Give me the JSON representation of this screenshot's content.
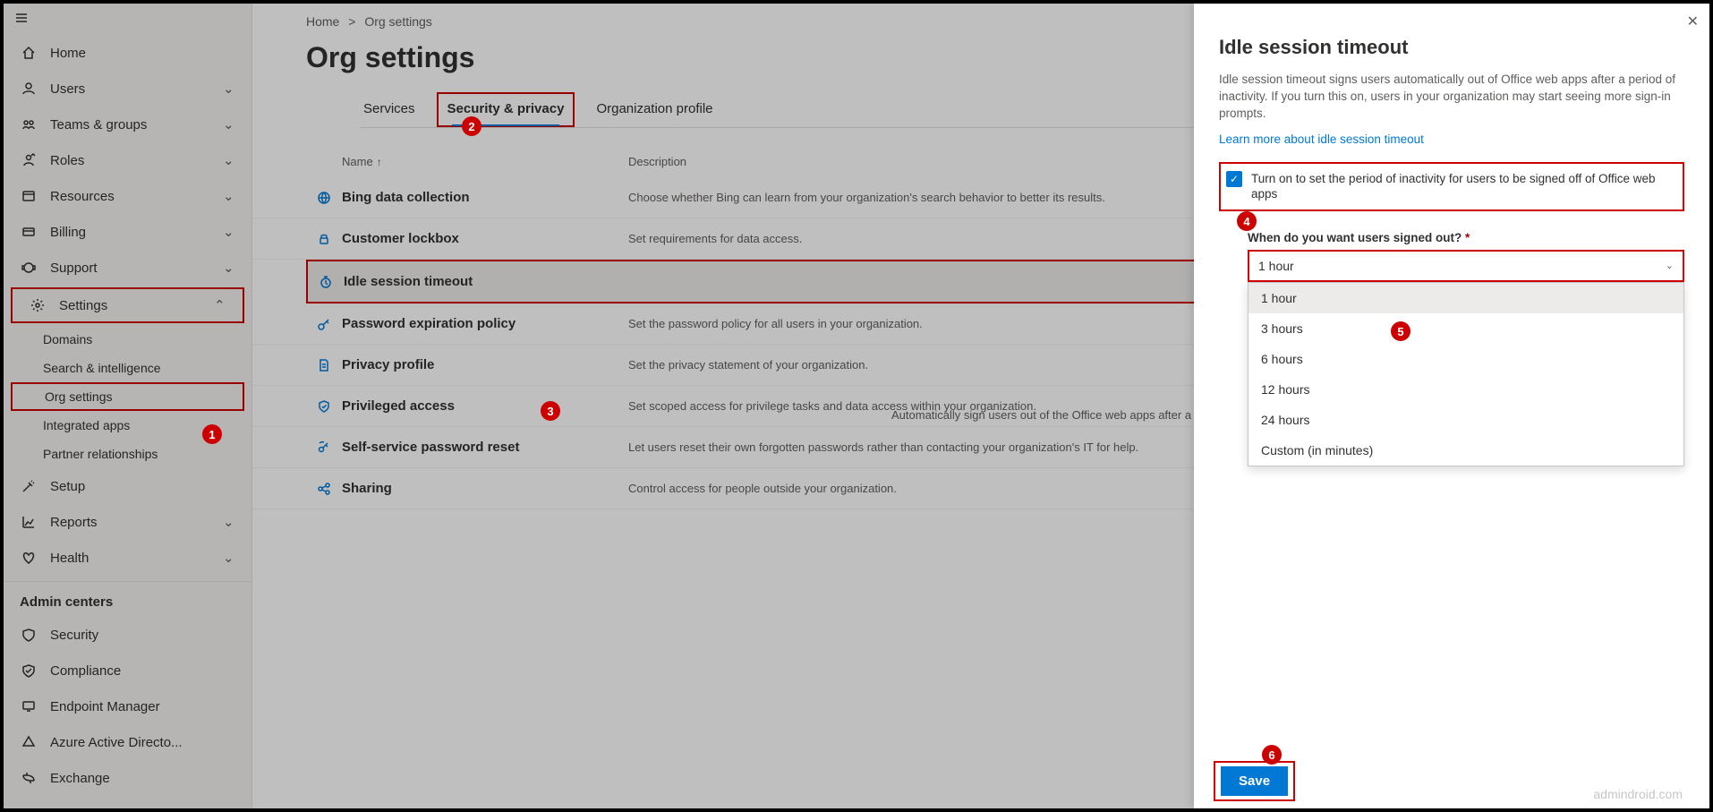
{
  "sidebar": {
    "items": [
      {
        "label": "Home",
        "chev": false
      },
      {
        "label": "Users",
        "chev": true
      },
      {
        "label": "Teams & groups",
        "chev": true
      },
      {
        "label": "Roles",
        "chev": true
      },
      {
        "label": "Resources",
        "chev": true
      },
      {
        "label": "Billing",
        "chev": true
      },
      {
        "label": "Support",
        "chev": true
      },
      {
        "label": "Settings",
        "chev": true
      }
    ],
    "settings_sub": [
      {
        "label": "Domains"
      },
      {
        "label": "Search & intelligence"
      },
      {
        "label": "Org settings"
      },
      {
        "label": "Integrated apps"
      },
      {
        "label": "Partner relationships"
      }
    ],
    "lower": [
      {
        "label": "Setup",
        "chev": false
      },
      {
        "label": "Reports",
        "chev": true
      },
      {
        "label": "Health",
        "chev": true
      }
    ],
    "admin_heading": "Admin centers",
    "admin": [
      {
        "label": "Security"
      },
      {
        "label": "Compliance"
      },
      {
        "label": "Endpoint Manager"
      },
      {
        "label": "Azure Active Directo..."
      },
      {
        "label": "Exchange"
      }
    ]
  },
  "breadcrumb": {
    "home": "Home",
    "sep": ">",
    "current": "Org settings"
  },
  "page_title": "Org settings",
  "tabs": [
    {
      "label": "Services"
    },
    {
      "label": "Security & privacy"
    },
    {
      "label": "Organization profile"
    }
  ],
  "table": {
    "col_name": "Name",
    "col_desc": "Description",
    "rows": [
      {
        "name": "Bing data collection",
        "desc": "Choose whether Bing can learn from your organization's search behavior to better its results."
      },
      {
        "name": "Customer lockbox",
        "desc": "Set requirements for data access."
      },
      {
        "name": "Idle session timeout",
        "desc": "Automatically sign users out of the Office web apps after a period of inactivity."
      },
      {
        "name": "Password expiration policy",
        "desc": "Set the password policy for all users in your organization."
      },
      {
        "name": "Privacy profile",
        "desc": "Set the privacy statement of your organization."
      },
      {
        "name": "Privileged access",
        "desc": "Set scoped access for privilege tasks and data access within your organization."
      },
      {
        "name": "Self-service password reset",
        "desc": "Let users reset their own forgotten passwords rather than contacting your organization's IT for help."
      },
      {
        "name": "Sharing",
        "desc": "Control access for people outside your organization."
      }
    ]
  },
  "panel": {
    "title": "Idle session timeout",
    "desc": "Idle session timeout signs users automatically out of Office web apps after a period of inactivity. If you turn this on, users in your organization may start seeing more sign-in prompts.",
    "learn": "Learn more about idle session timeout",
    "toggle_label": "Turn on to set the period of inactivity for users to be signed off of Office web apps",
    "field_label": "When do you want users signed out?",
    "selected": "1 hour",
    "options": [
      "1 hour",
      "3 hours",
      "6 hours",
      "12 hours",
      "24 hours",
      "Custom (in minutes)"
    ],
    "save": "Save"
  },
  "watermark": "admindroid.com",
  "markers": {
    "1": "1",
    "2": "2",
    "3": "3",
    "4": "4",
    "5": "5",
    "6": "6"
  }
}
